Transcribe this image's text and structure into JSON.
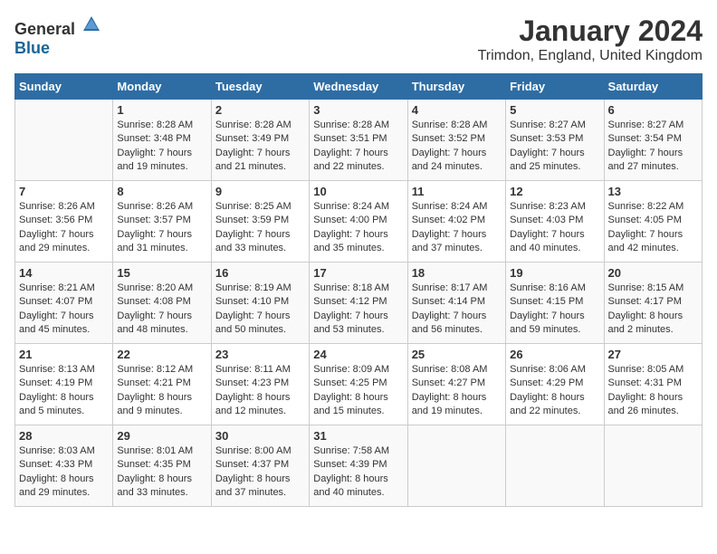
{
  "header": {
    "logo_general": "General",
    "logo_blue": "Blue",
    "month": "January 2024",
    "location": "Trimdon, England, United Kingdom"
  },
  "days_of_week": [
    "Sunday",
    "Monday",
    "Tuesday",
    "Wednesday",
    "Thursday",
    "Friday",
    "Saturday"
  ],
  "weeks": [
    [
      {
        "day": "",
        "sunrise": "",
        "sunset": "",
        "daylight": ""
      },
      {
        "day": "1",
        "sunrise": "Sunrise: 8:28 AM",
        "sunset": "Sunset: 3:48 PM",
        "daylight": "Daylight: 7 hours and 19 minutes."
      },
      {
        "day": "2",
        "sunrise": "Sunrise: 8:28 AM",
        "sunset": "Sunset: 3:49 PM",
        "daylight": "Daylight: 7 hours and 21 minutes."
      },
      {
        "day": "3",
        "sunrise": "Sunrise: 8:28 AM",
        "sunset": "Sunset: 3:51 PM",
        "daylight": "Daylight: 7 hours and 22 minutes."
      },
      {
        "day": "4",
        "sunrise": "Sunrise: 8:28 AM",
        "sunset": "Sunset: 3:52 PM",
        "daylight": "Daylight: 7 hours and 24 minutes."
      },
      {
        "day": "5",
        "sunrise": "Sunrise: 8:27 AM",
        "sunset": "Sunset: 3:53 PM",
        "daylight": "Daylight: 7 hours and 25 minutes."
      },
      {
        "day": "6",
        "sunrise": "Sunrise: 8:27 AM",
        "sunset": "Sunset: 3:54 PM",
        "daylight": "Daylight: 7 hours and 27 minutes."
      }
    ],
    [
      {
        "day": "7",
        "sunrise": "Sunrise: 8:26 AM",
        "sunset": "Sunset: 3:56 PM",
        "daylight": "Daylight: 7 hours and 29 minutes."
      },
      {
        "day": "8",
        "sunrise": "Sunrise: 8:26 AM",
        "sunset": "Sunset: 3:57 PM",
        "daylight": "Daylight: 7 hours and 31 minutes."
      },
      {
        "day": "9",
        "sunrise": "Sunrise: 8:25 AM",
        "sunset": "Sunset: 3:59 PM",
        "daylight": "Daylight: 7 hours and 33 minutes."
      },
      {
        "day": "10",
        "sunrise": "Sunrise: 8:24 AM",
        "sunset": "Sunset: 4:00 PM",
        "daylight": "Daylight: 7 hours and 35 minutes."
      },
      {
        "day": "11",
        "sunrise": "Sunrise: 8:24 AM",
        "sunset": "Sunset: 4:02 PM",
        "daylight": "Daylight: 7 hours and 37 minutes."
      },
      {
        "day": "12",
        "sunrise": "Sunrise: 8:23 AM",
        "sunset": "Sunset: 4:03 PM",
        "daylight": "Daylight: 7 hours and 40 minutes."
      },
      {
        "day": "13",
        "sunrise": "Sunrise: 8:22 AM",
        "sunset": "Sunset: 4:05 PM",
        "daylight": "Daylight: 7 hours and 42 minutes."
      }
    ],
    [
      {
        "day": "14",
        "sunrise": "Sunrise: 8:21 AM",
        "sunset": "Sunset: 4:07 PM",
        "daylight": "Daylight: 7 hours and 45 minutes."
      },
      {
        "day": "15",
        "sunrise": "Sunrise: 8:20 AM",
        "sunset": "Sunset: 4:08 PM",
        "daylight": "Daylight: 7 hours and 48 minutes."
      },
      {
        "day": "16",
        "sunrise": "Sunrise: 8:19 AM",
        "sunset": "Sunset: 4:10 PM",
        "daylight": "Daylight: 7 hours and 50 minutes."
      },
      {
        "day": "17",
        "sunrise": "Sunrise: 8:18 AM",
        "sunset": "Sunset: 4:12 PM",
        "daylight": "Daylight: 7 hours and 53 minutes."
      },
      {
        "day": "18",
        "sunrise": "Sunrise: 8:17 AM",
        "sunset": "Sunset: 4:14 PM",
        "daylight": "Daylight: 7 hours and 56 minutes."
      },
      {
        "day": "19",
        "sunrise": "Sunrise: 8:16 AM",
        "sunset": "Sunset: 4:15 PM",
        "daylight": "Daylight: 7 hours and 59 minutes."
      },
      {
        "day": "20",
        "sunrise": "Sunrise: 8:15 AM",
        "sunset": "Sunset: 4:17 PM",
        "daylight": "Daylight: 8 hours and 2 minutes."
      }
    ],
    [
      {
        "day": "21",
        "sunrise": "Sunrise: 8:13 AM",
        "sunset": "Sunset: 4:19 PM",
        "daylight": "Daylight: 8 hours and 5 minutes."
      },
      {
        "day": "22",
        "sunrise": "Sunrise: 8:12 AM",
        "sunset": "Sunset: 4:21 PM",
        "daylight": "Daylight: 8 hours and 9 minutes."
      },
      {
        "day": "23",
        "sunrise": "Sunrise: 8:11 AM",
        "sunset": "Sunset: 4:23 PM",
        "daylight": "Daylight: 8 hours and 12 minutes."
      },
      {
        "day": "24",
        "sunrise": "Sunrise: 8:09 AM",
        "sunset": "Sunset: 4:25 PM",
        "daylight": "Daylight: 8 hours and 15 minutes."
      },
      {
        "day": "25",
        "sunrise": "Sunrise: 8:08 AM",
        "sunset": "Sunset: 4:27 PM",
        "daylight": "Daylight: 8 hours and 19 minutes."
      },
      {
        "day": "26",
        "sunrise": "Sunrise: 8:06 AM",
        "sunset": "Sunset: 4:29 PM",
        "daylight": "Daylight: 8 hours and 22 minutes."
      },
      {
        "day": "27",
        "sunrise": "Sunrise: 8:05 AM",
        "sunset": "Sunset: 4:31 PM",
        "daylight": "Daylight: 8 hours and 26 minutes."
      }
    ],
    [
      {
        "day": "28",
        "sunrise": "Sunrise: 8:03 AM",
        "sunset": "Sunset: 4:33 PM",
        "daylight": "Daylight: 8 hours and 29 minutes."
      },
      {
        "day": "29",
        "sunrise": "Sunrise: 8:01 AM",
        "sunset": "Sunset: 4:35 PM",
        "daylight": "Daylight: 8 hours and 33 minutes."
      },
      {
        "day": "30",
        "sunrise": "Sunrise: 8:00 AM",
        "sunset": "Sunset: 4:37 PM",
        "daylight": "Daylight: 8 hours and 37 minutes."
      },
      {
        "day": "31",
        "sunrise": "Sunrise: 7:58 AM",
        "sunset": "Sunset: 4:39 PM",
        "daylight": "Daylight: 8 hours and 40 minutes."
      },
      {
        "day": "",
        "sunrise": "",
        "sunset": "",
        "daylight": ""
      },
      {
        "day": "",
        "sunrise": "",
        "sunset": "",
        "daylight": ""
      },
      {
        "day": "",
        "sunrise": "",
        "sunset": "",
        "daylight": ""
      }
    ]
  ]
}
